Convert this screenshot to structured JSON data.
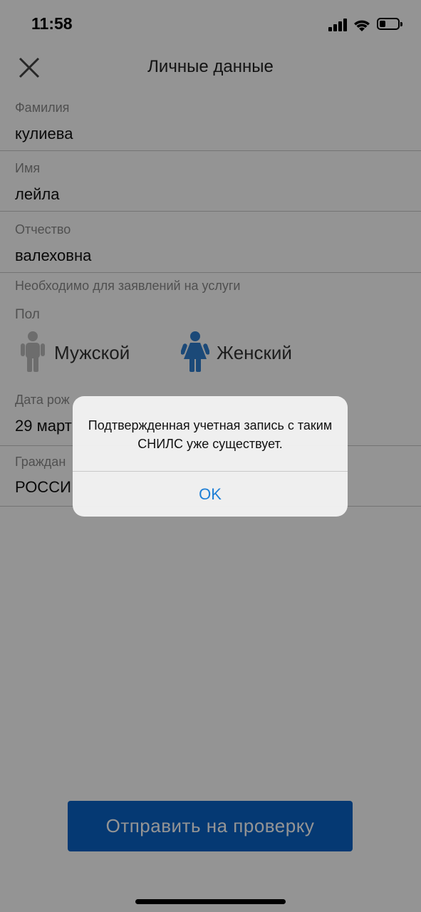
{
  "status_bar": {
    "time": "11:58",
    "icons": [
      "signal-icon",
      "wifi-icon",
      "battery-icon"
    ]
  },
  "header": {
    "title": "Личные данные",
    "close_icon": "close-icon"
  },
  "form": {
    "last_name": {
      "label": "Фамилия",
      "value": "кулиева"
    },
    "first_name": {
      "label": "Имя",
      "value": "лейла"
    },
    "patronymic": {
      "label": "Отчество",
      "value": "валеховна"
    },
    "hint": "Необходимо для заявлений на услуги",
    "gender": {
      "label": "Пол",
      "male": "Мужской",
      "female": "Женский",
      "selected": "female"
    },
    "birth_date": {
      "label": "Дата рож",
      "value": "29 март"
    },
    "citizenship": {
      "label": "Граждан",
      "value": "РОССИ"
    }
  },
  "submit_button": {
    "label": "Отправить на проверку"
  },
  "alert": {
    "message": "Подтвержденная учетная запись с таким СНИЛС уже существует.",
    "ok_label": "OK"
  },
  "colors": {
    "accent": "#0a63c7",
    "link": "#1e7fd6",
    "female_icon": "#2f7fcf",
    "male_icon": "#bcbcbc"
  }
}
